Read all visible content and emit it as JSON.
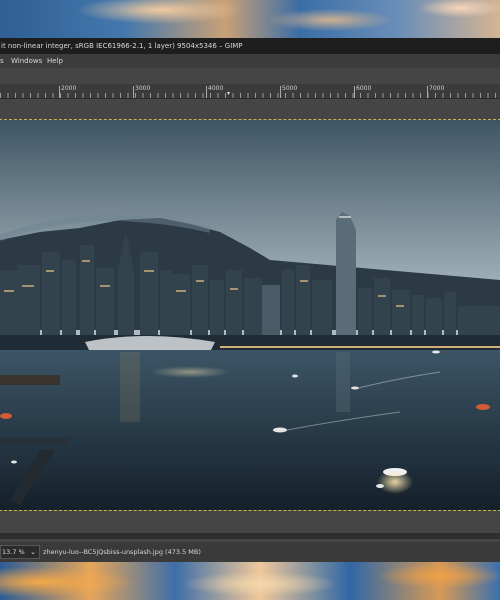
{
  "window": {
    "title": "it non-linear integer, sRGB IEC61966-2.1, 1 layer) 9504x5346 – GIMP"
  },
  "menubar": {
    "items": [
      "s",
      "Windows",
      "Help"
    ]
  },
  "ruler": {
    "labels": [
      "2000",
      "3000",
      "4000",
      "5000",
      "6000",
      "7000"
    ]
  },
  "statusbar": {
    "zoom": "13.7 %",
    "file_info": "zhenyu-luo--BC5jQsbiss-unsplash.jpg (473.5 MB)"
  },
  "colors": {
    "title_bg": "#1e1e1e",
    "menu_bg": "#3c3c3c",
    "canvas_bg": "#454545",
    "selection_dash": "#c9b64a"
  }
}
